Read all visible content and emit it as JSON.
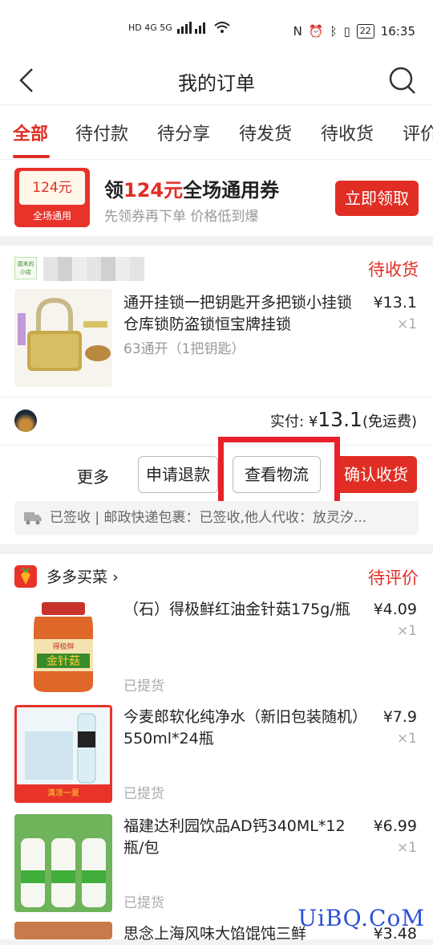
{
  "status_bar": {
    "network_left": "HD 4G 5G",
    "time": "16:35",
    "battery": "22"
  },
  "nav": {
    "title": "我的订单"
  },
  "tabs": [
    "全部",
    "待付款",
    "待分享",
    "待发货",
    "待收货",
    "评价"
  ],
  "active_tab": "全部",
  "coupon": {
    "ticket_amount": "124元",
    "ticket_label": "全场通用",
    "title_prefix": "领",
    "title_amount": "124元",
    "title_suffix": "全场通用券",
    "subtitle": "先领券再下单  价格低到爆",
    "button": "立即领取"
  },
  "order1": {
    "shop_logo_text": "德禾的小店",
    "status": "待收货",
    "item": {
      "name": "通开挂锁一把钥匙开多把锁小挂锁仓库锁防盗锁恒宝牌挂锁",
      "price": "¥13.1",
      "qty": "×1",
      "spec": "63通开（1把钥匙）"
    },
    "paid_label": "实付: ",
    "paid_currency": "¥",
    "paid_amount": "13.1",
    "paid_note": "(免运费)",
    "more": "更多",
    "buttons": {
      "refund": "申请退款",
      "logistics": "查看物流",
      "confirm": "确认收货"
    },
    "logistics_text": "已签收 | 邮政快递包裹：已签收,他人代收：放灵汐..."
  },
  "order2": {
    "shop_name": "多多买菜",
    "status": "待评价",
    "items": [
      {
        "name": "（石）得极鲜红油金针菇175g/瓶",
        "price": "¥4.09",
        "qty": "×1",
        "state": "已提货"
      },
      {
        "name": "今麦郎软化纯净水（新旧包装随机）550ml*24瓶",
        "price": "¥7.9",
        "qty": "×1",
        "state": "已提货"
      },
      {
        "name": "福建达利园饮品AD钙340ML*12瓶/包",
        "price": "¥6.99",
        "qty": "×1",
        "state": "已提货"
      },
      {
        "name": "思念上海风味大馅馄饨三鲜",
        "price": "¥3.48",
        "qty": "",
        "state": ""
      }
    ]
  },
  "watermark": "UiBQ.CoM",
  "colors": {
    "accent": "#e02e24",
    "highlight_box": "#e8202a"
  }
}
